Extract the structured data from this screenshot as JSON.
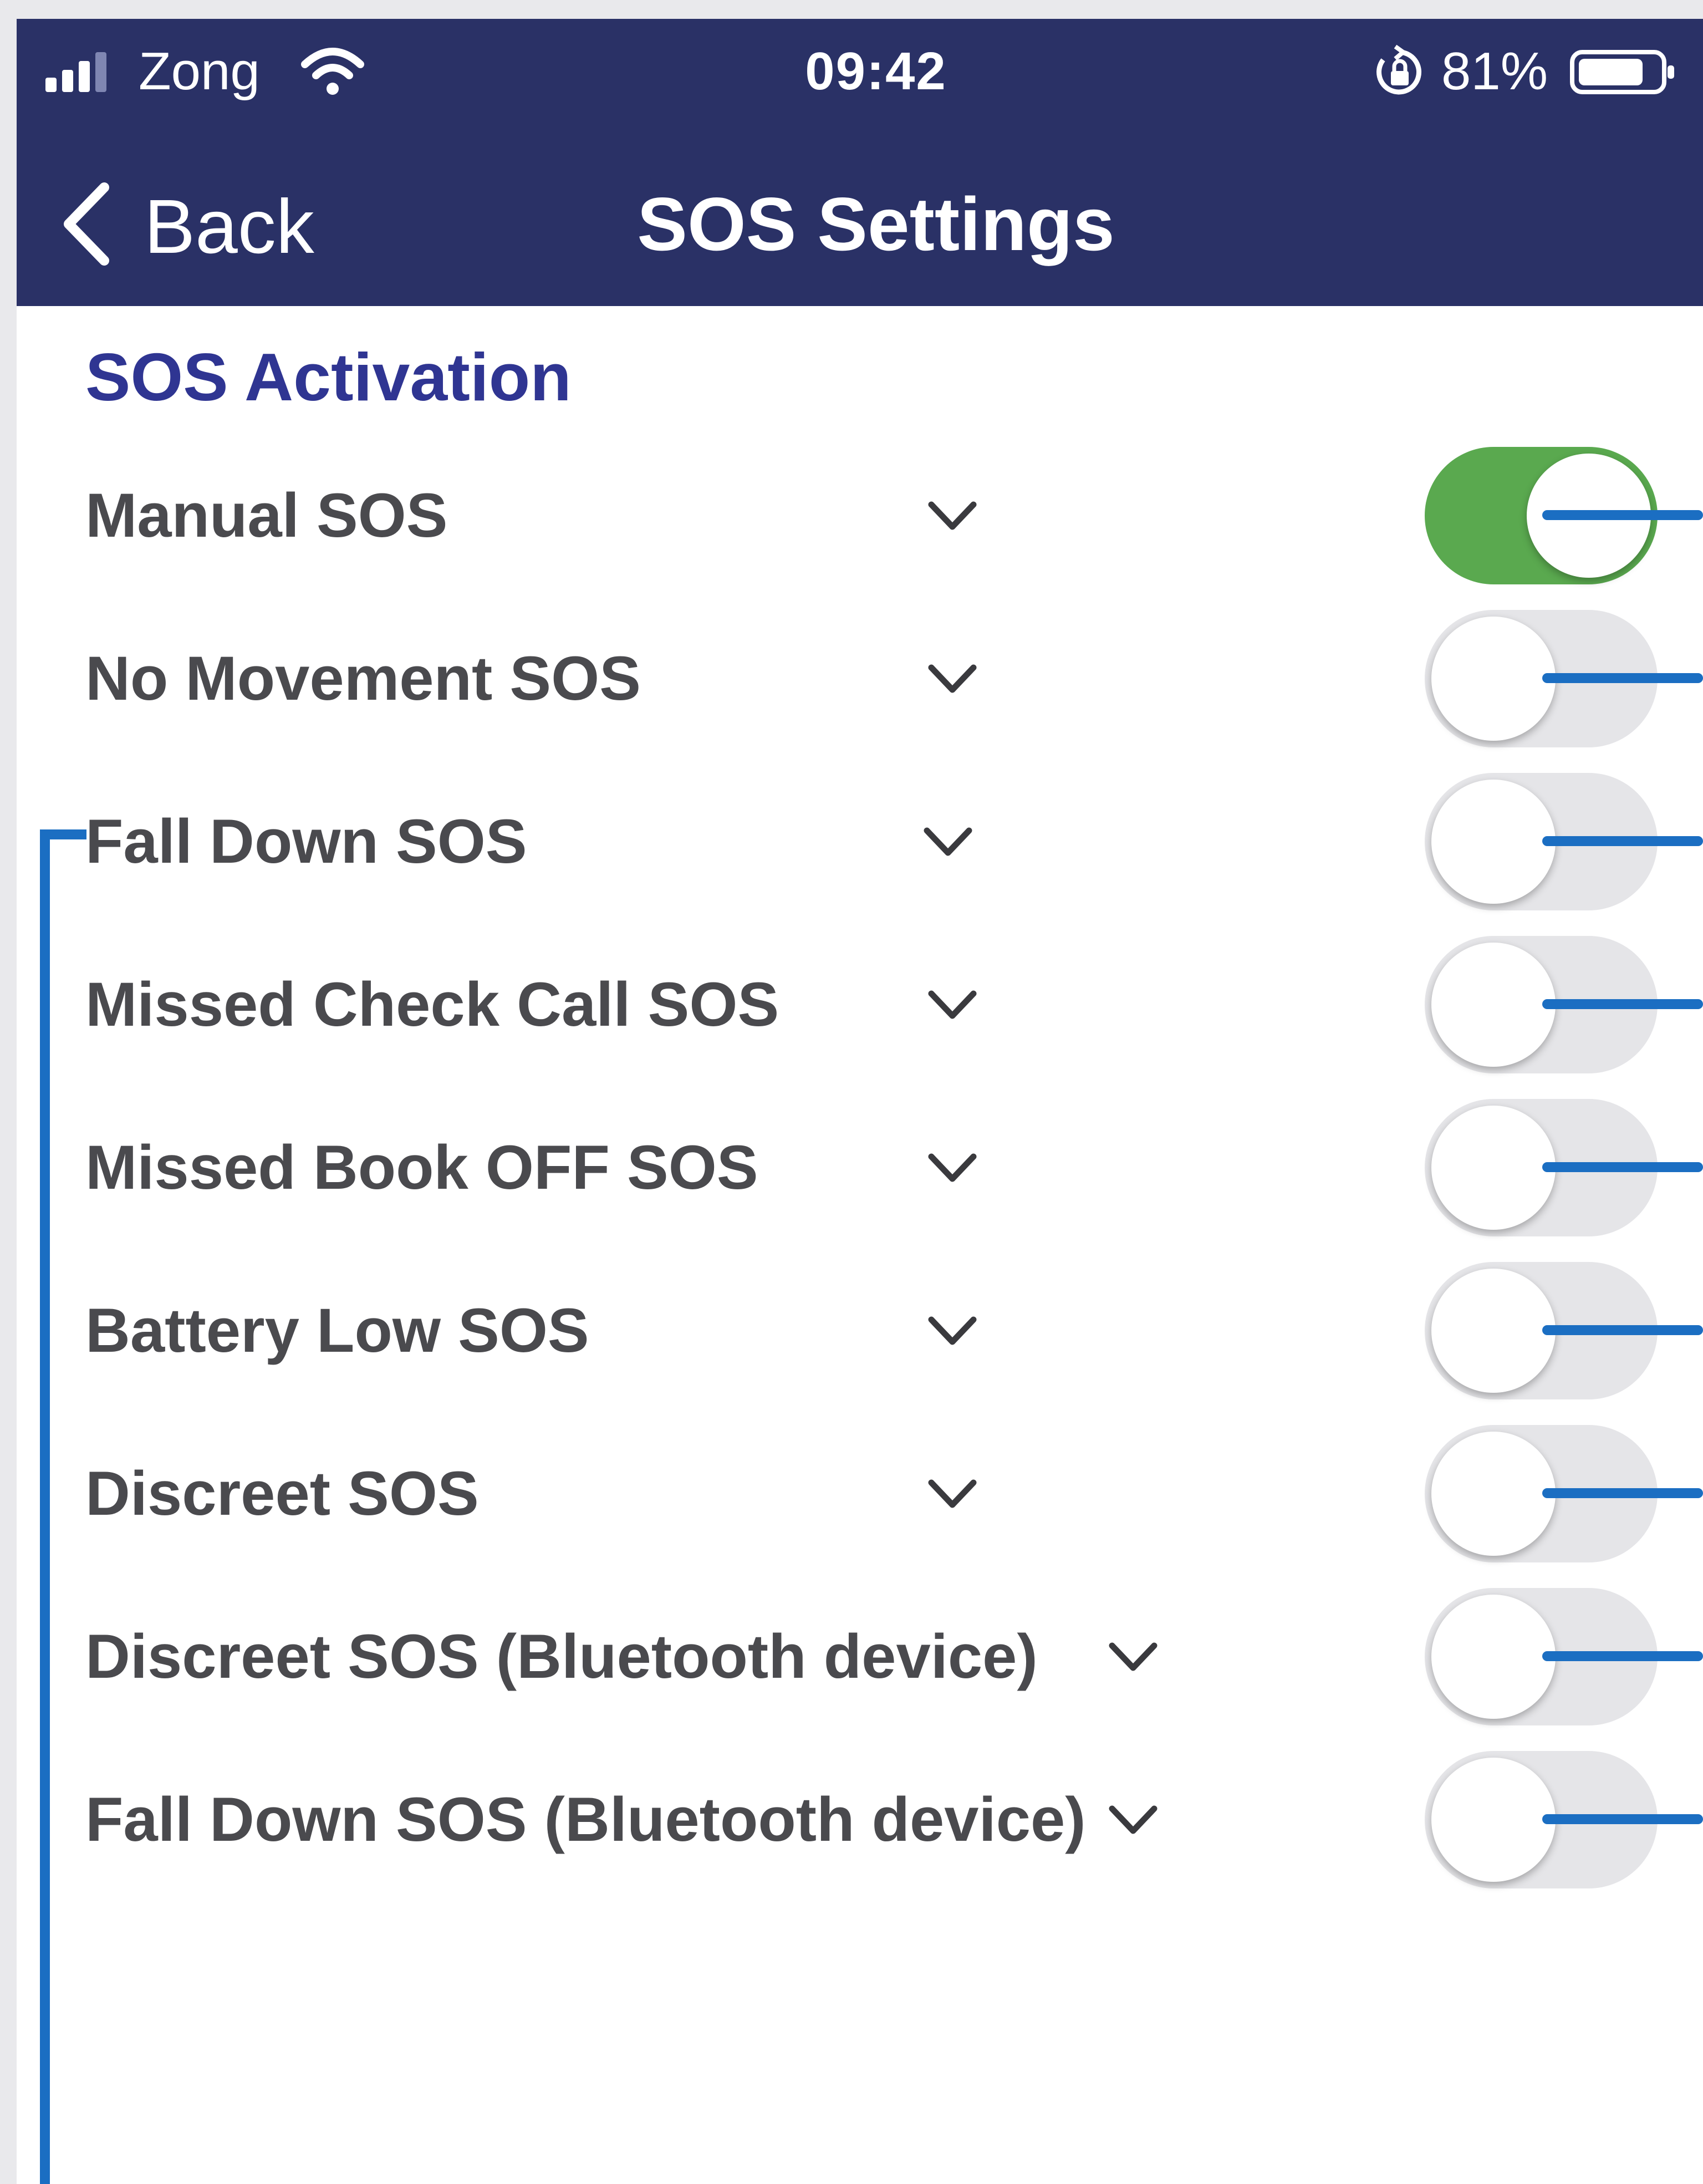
{
  "status_bar": {
    "carrier": "Zong",
    "time": "09:42",
    "battery_percent": "81%",
    "battery_level": 0.81,
    "signal_icon": "signal-bars-icon",
    "wifi_icon": "wifi-icon",
    "orientation_lock_icon": "orientation-lock-icon"
  },
  "nav": {
    "back_label": "Back",
    "title": "SOS Settings"
  },
  "section": {
    "title": "SOS Activation"
  },
  "settings": [
    {
      "label": "Manual SOS",
      "enabled": true
    },
    {
      "label": "No Movement SOS",
      "enabled": false
    },
    {
      "label": "Fall Down SOS",
      "enabled": false
    },
    {
      "label": "Missed Check Call SOS",
      "enabled": false
    },
    {
      "label": "Missed Book OFF SOS",
      "enabled": false
    },
    {
      "label": "Battery Low SOS",
      "enabled": false
    },
    {
      "label": "Discreet SOS",
      "enabled": false
    },
    {
      "label": "Discreet SOS (Bluetooth device)",
      "enabled": false
    },
    {
      "label": "Fall Down SOS (Bluetooth device)",
      "enabled": false
    }
  ],
  "colors": {
    "header": "#2a3166",
    "section_title": "#2f3592",
    "toggle_on": "#5aa94f",
    "toggle_off": "#e5e5e8",
    "annotation": "#1b6ec2"
  }
}
